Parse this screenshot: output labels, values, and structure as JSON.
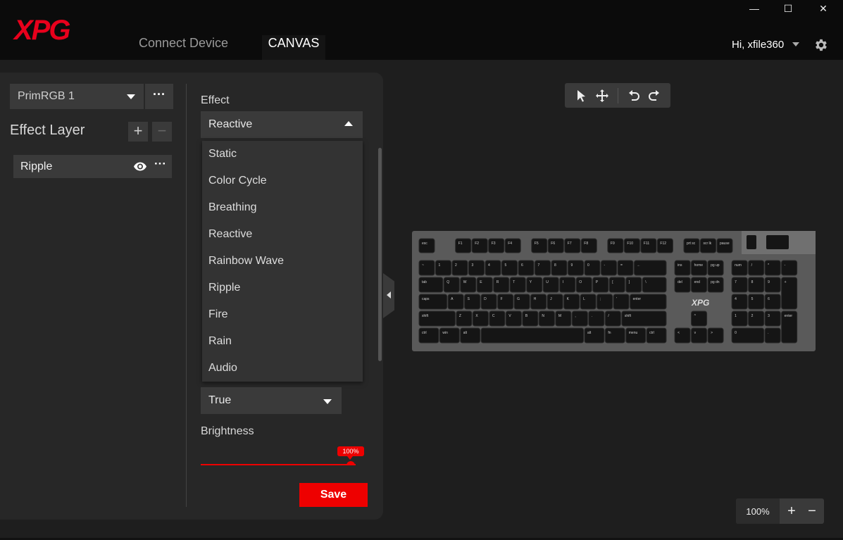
{
  "app": {
    "brand": "XPG",
    "brand_color": "#e8001c",
    "accent": "#ee0000"
  },
  "nav": {
    "tabs": [
      {
        "label": "Connect Device",
        "active": false
      },
      {
        "label": "CANVAS",
        "active": true
      }
    ]
  },
  "window": {
    "minimize": "—",
    "maximize": "☐",
    "close": "✕"
  },
  "user": {
    "greeting": "Hi, xfile360",
    "settings_icon": "gear-icon"
  },
  "profile": {
    "selected": "PrimRGB 1",
    "more": "···"
  },
  "effect_layer": {
    "title": "Effect Layer",
    "add": "+",
    "remove": "−",
    "layers": [
      {
        "label": "Ripple",
        "visible_icon": "eye-icon",
        "more": "···"
      }
    ]
  },
  "effect": {
    "label": "Effect",
    "selected": "Reactive",
    "options": [
      "Static",
      "Color Cycle",
      "Breathing",
      "Reactive",
      "Rainbow Wave",
      "Ripple",
      "Fire",
      "Rain",
      "Audio"
    ]
  },
  "second_select": {
    "selected": "True"
  },
  "brightness": {
    "label": "Brightness",
    "value_text": "100%",
    "value": 1.0
  },
  "save": {
    "label": "Save"
  },
  "toolbar": {
    "icons": [
      "pointer-icon",
      "move-icon",
      "undo-icon",
      "redo-icon"
    ]
  },
  "keyboard": {
    "logo": "XPG",
    "rows": [
      [
        "esc",
        "F1",
        "F2",
        "F3",
        "F4",
        "F5",
        "F6",
        "F7",
        "F8",
        "F9",
        "F10",
        "F11",
        "F12",
        "prt sc",
        "scr lk",
        "pause"
      ],
      [
        "~",
        "1",
        "2",
        "3",
        "4",
        "5",
        "6",
        "7",
        "8",
        "9",
        "0",
        "-",
        "=",
        "←",
        "ins",
        "home",
        "pg up",
        "num",
        "/",
        "*",
        "-"
      ],
      [
        "tab",
        "Q",
        "W",
        "E",
        "R",
        "T",
        "Y",
        "U",
        "I",
        "O",
        "P",
        "[",
        "]",
        "\\",
        "del",
        "end",
        "pg dn",
        "7",
        "8",
        "9",
        "+"
      ],
      [
        "caps",
        "A",
        "S",
        "D",
        "F",
        "G",
        "H",
        "J",
        "K",
        "L",
        ";",
        "'",
        "enter",
        "4",
        "5",
        "6"
      ],
      [
        "shift",
        "Z",
        "X",
        "C",
        "V",
        "B",
        "N",
        "M",
        ",",
        ".",
        "/",
        "shift",
        "^",
        "1",
        "2",
        "3",
        "enter"
      ],
      [
        "ctrl",
        "win",
        "alt",
        "",
        "alt",
        "fn",
        "menu",
        "ctrl",
        "<",
        "v",
        ">",
        "0",
        "."
      ]
    ]
  },
  "zoom": {
    "level": "100%",
    "in": "+",
    "out": "−"
  }
}
